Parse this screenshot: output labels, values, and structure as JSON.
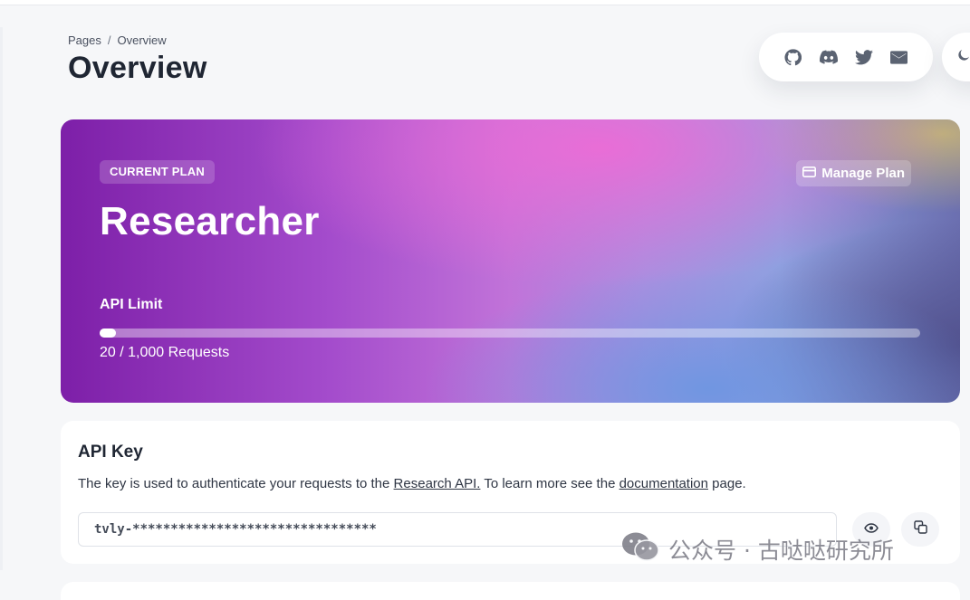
{
  "breadcrumb": {
    "root": "Pages",
    "separator": "/",
    "current": "Overview"
  },
  "page": {
    "title": "Overview"
  },
  "social": {
    "icons": [
      "github-icon",
      "discord-icon",
      "twitter-icon",
      "mail-icon"
    ]
  },
  "theme": {
    "icon": "moon-icon"
  },
  "plan": {
    "badge": "CURRENT PLAN",
    "name": "Researcher",
    "manage_label": "Manage Plan",
    "limit_label": "API Limit",
    "usage_text": "20 / 1,000 Requests",
    "used": 20,
    "limit": 1000
  },
  "api_key": {
    "title": "API Key",
    "desc_before": "The key is used to authenticate your requests to the ",
    "link_research": "Research API.",
    "desc_middle": " To learn more see the ",
    "link_docs": "documentation",
    "desc_after": " page.",
    "value": "tvly-********************************",
    "show_icon": "eye-icon",
    "copy_icon": "copy-icon"
  },
  "watermark": {
    "text": "公众号 · 古哒哒研究所",
    "icon": "wechat-icon"
  },
  "colors": {
    "text_dark": "#1f2633",
    "card_bg": "#ffffff",
    "page_bg": "#f6f7f9"
  }
}
